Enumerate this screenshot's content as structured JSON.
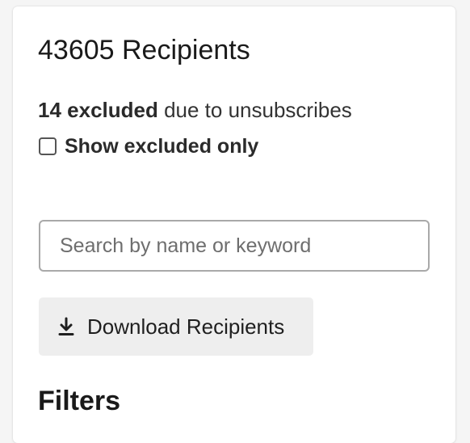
{
  "recipients": {
    "count": "43605",
    "title_suffix": " Recipients"
  },
  "exclusions": {
    "count_text": "14 excluded",
    "reason_text": " due to unsubscribes",
    "checkbox_label": "Show excluded only",
    "checkbox_checked": false
  },
  "search": {
    "placeholder": "Search by name or keyword",
    "value": ""
  },
  "download": {
    "label": "Download Recipients",
    "icon": "download-icon"
  },
  "filters": {
    "title": "Filters"
  }
}
